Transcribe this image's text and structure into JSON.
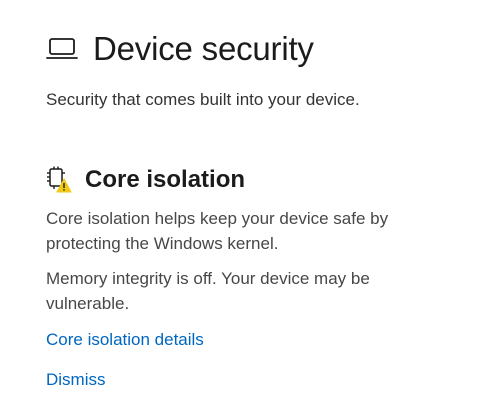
{
  "header": {
    "icon": "laptop-icon",
    "title": "Device security",
    "subtitle": "Security that comes built into your device."
  },
  "core_isolation": {
    "icon": "core-isolation-warning-icon",
    "title": "Core isolation",
    "description": "Core isolation helps keep your device safe by protecting the Windows kernel.",
    "status": "Memory integrity is off. Your device may be vulnerable.",
    "details_link": "Core isolation details",
    "dismiss_link": "Dismiss"
  },
  "colors": {
    "link": "#0067c0",
    "warning": "#f2c811",
    "text": "#1b1b1b"
  }
}
